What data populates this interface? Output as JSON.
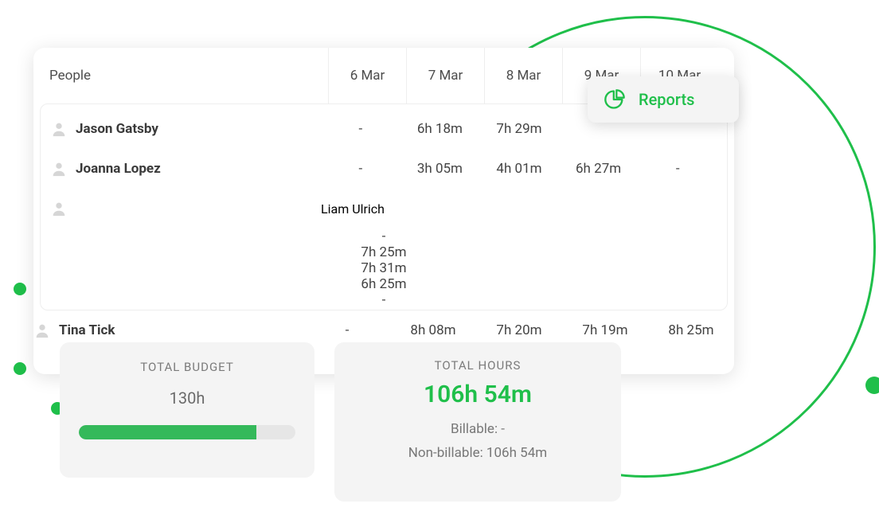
{
  "timesheet": {
    "people_header": "People",
    "days": [
      "6 Mar",
      "7 Mar",
      "8 Mar",
      "9 Mar",
      "10 Mar"
    ],
    "rows": [
      {
        "name": "Jason Gatsby",
        "cells": [
          "-",
          "6h  18m",
          "7h  29m",
          "",
          ""
        ]
      },
      {
        "name": "Joanna Lopez",
        "cells": [
          "-",
          "3h  05m",
          "4h  01m",
          "6h  27m",
          "-"
        ]
      },
      {
        "name": "Liam Ulrich",
        "cells": [
          "-",
          "7h  25m",
          "7h  31m",
          "6h  25m",
          "-"
        ]
      },
      {
        "name": "Tina Tick",
        "cells": [
          "-",
          "8h  08m",
          "7h  20m",
          "7h  19m",
          "8h  25m"
        ]
      }
    ]
  },
  "reports": {
    "label": "Reports"
  },
  "budget": {
    "title": "TOTAL BUDGET",
    "value": "130h",
    "progress_pct": 82
  },
  "hours": {
    "title": "TOTAL HOURS",
    "total": "106h 54m",
    "billable": "Billable: -",
    "nonbillable": "Non-billable: 106h 54m"
  }
}
